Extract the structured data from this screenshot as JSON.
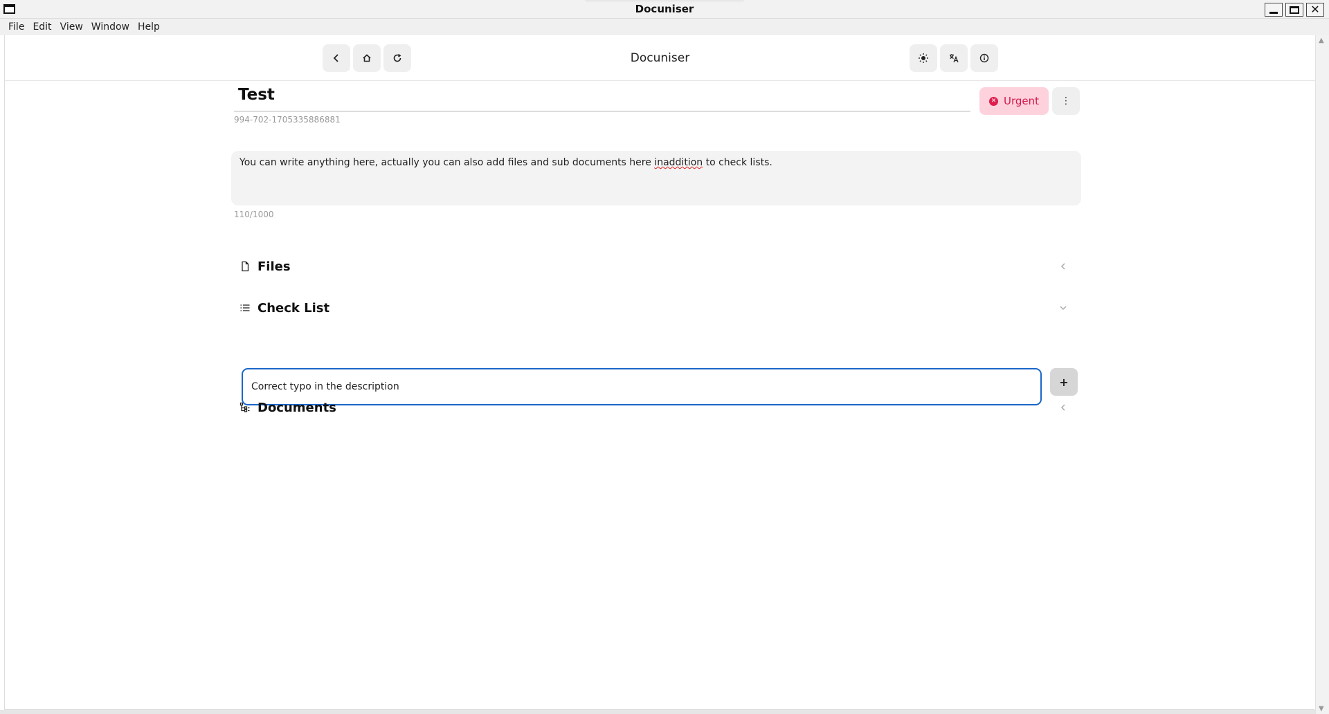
{
  "window": {
    "title": "Docuniser"
  },
  "menubar": {
    "items": [
      "File",
      "Edit",
      "View",
      "Window",
      "Help"
    ]
  },
  "toolbar": {
    "app_title": "Docuniser"
  },
  "document": {
    "title": "Test",
    "id": "994-702-1705335886881",
    "priority_label": "Urgent",
    "description_before": "You can write anything here, actually you can also add files and sub documents here ",
    "description_typo": "inaddition",
    "description_after": " to check lists.",
    "char_count": "110/1000"
  },
  "sections": {
    "files": "Files",
    "checklist": "Check List",
    "documents": "Documents"
  },
  "checklist": {
    "input_value": "Correct typo in the description",
    "add_label": "+"
  },
  "colors": {
    "accent": "#1a66c8",
    "urgent_bg": "#fdd2dc",
    "urgent_fg": "#d4194a"
  },
  "icons": [
    "back-icon",
    "home-icon",
    "refresh-icon",
    "sun-icon",
    "translate-icon",
    "info-icon",
    "more-vertical-icon",
    "file-icon",
    "list-icon",
    "tree-icon",
    "chevron-left-icon",
    "chevron-down-icon"
  ]
}
